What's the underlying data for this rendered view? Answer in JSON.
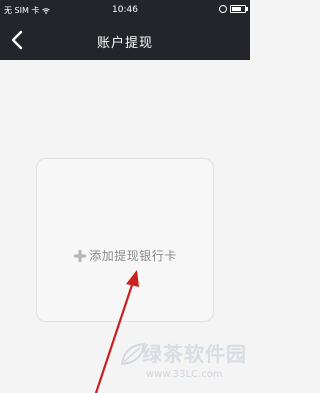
{
  "status_bar": {
    "carrier": "无 SIM 卡",
    "time": "10:46"
  },
  "nav": {
    "title": "账户提现"
  },
  "add_card": {
    "label": "添加提现银行卡"
  },
  "watermark": {
    "title": "绿茶软件园",
    "url": "www.33LC.com"
  },
  "colors": {
    "nav_bg": "#24252a",
    "page_bg": "#f4f4f4",
    "arrow": "#cc1f1f"
  }
}
